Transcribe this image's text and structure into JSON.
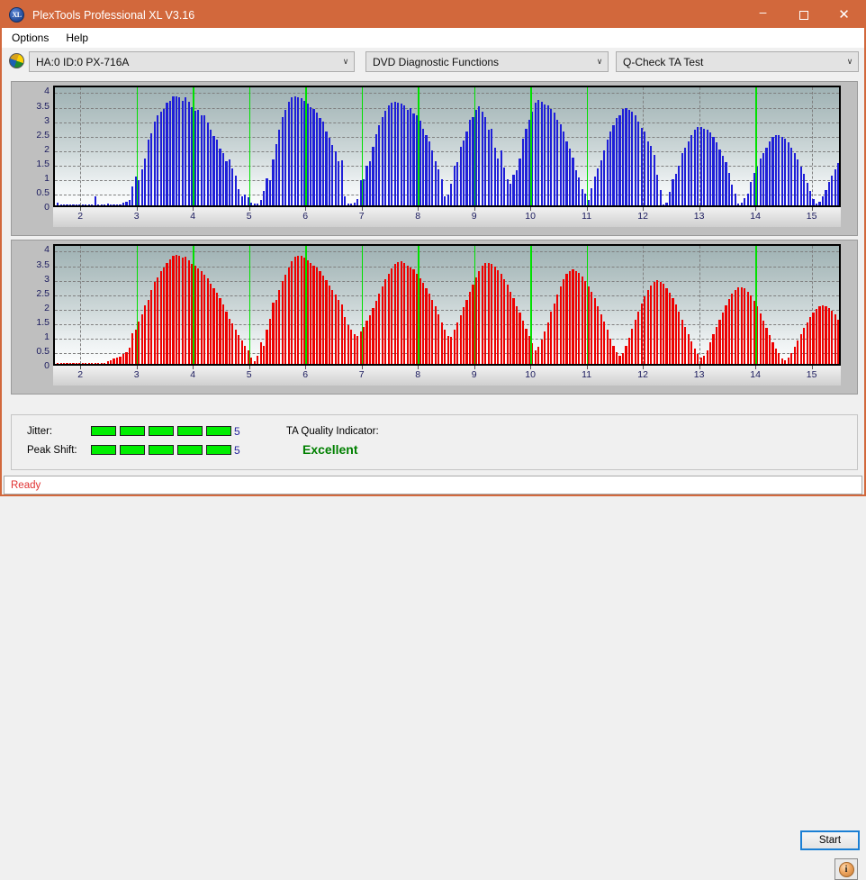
{
  "window": {
    "title": "PlexTools Professional XL V3.16",
    "icon": "xl-app-icon",
    "controls": {
      "minimize": "–",
      "maximize": "❑",
      "close": "✕"
    },
    "accent_color": "#d2683c"
  },
  "menubar": {
    "items": [
      {
        "label": "Options"
      },
      {
        "label": "Help"
      }
    ]
  },
  "toolbar": {
    "drive_icon": "disc-icon",
    "drive": {
      "value": "HA:0 ID:0  PX-716A",
      "chevron": "∨"
    },
    "category": {
      "value": "DVD Diagnostic Functions",
      "chevron": "∨"
    },
    "test": {
      "value": "Q-Check TA Test",
      "chevron": "∨"
    }
  },
  "results": {
    "jitter_label": "Jitter:",
    "jitter_value": "5",
    "jitter_segments": 5,
    "peak_shift_label": "Peak Shift:",
    "peak_shift_value": "5",
    "peak_shift_segments": 5,
    "quality_label": "TA Quality Indicator:",
    "quality_value": "Excellent",
    "quality_color": "#008000",
    "meter_color": "#00ee00"
  },
  "actions": {
    "start_label": "Start",
    "info_label": "i"
  },
  "statusbar": {
    "text": "Ready",
    "color": "#e03232"
  },
  "chart_data": [
    {
      "id": "ta-test-upper",
      "type": "bar",
      "title": "",
      "xlabel": "",
      "ylabel": "",
      "color": "#1f1fd8",
      "series_name": "TA Test Upper",
      "xlim": [
        1.55,
        15.55
      ],
      "ylim": [
        0,
        4.2
      ],
      "yticks": [
        0,
        0.5,
        1,
        1.5,
        2,
        2.5,
        3,
        3.5,
        4
      ],
      "ytick_labels": [
        "0",
        "0.5",
        "1",
        "1.5",
        "2",
        "2.5",
        "3",
        "3.5",
        "4"
      ],
      "xticks": [
        2,
        3,
        4,
        5,
        6,
        7,
        8,
        9,
        10,
        11,
        12,
        13,
        14,
        15
      ],
      "xtick_labels": [
        "2",
        "3",
        "4",
        "5",
        "6",
        "7",
        "8",
        "9",
        "10",
        "11",
        "12",
        "13",
        "14",
        "15"
      ],
      "grid": true,
      "markers": [
        3,
        4,
        5,
        6,
        7,
        8,
        9,
        10,
        11,
        14
      ],
      "marker_color": "#00e000",
      "bar_step": 0.0555,
      "x_start": 1.6,
      "values": [
        0.08,
        0.02,
        0.04,
        0.02,
        0.02,
        0.03,
        0.02,
        0.02,
        0.04,
        0.02,
        0.02,
        0.02,
        0.32,
        0.02,
        0.03,
        0.02,
        0.05,
        0.04,
        0.02,
        0.02,
        0.02,
        0.1,
        0.12,
        0.2,
        0.65,
        1.0,
        0.88,
        1.24,
        1.62,
        2.28,
        2.5,
        2.9,
        3.1,
        3.25,
        3.32,
        3.55,
        3.62,
        3.75,
        3.78,
        3.74,
        3.62,
        3.72,
        3.58,
        3.4,
        3.28,
        3.3,
        3.1,
        3.12,
        2.85,
        2.62,
        2.4,
        2.28,
        1.95,
        1.8,
        1.52,
        1.6,
        1.28,
        1.02,
        0.55,
        0.32,
        0.36,
        0.28,
        0.1,
        0.06,
        0.06,
        0.18,
        0.5,
        0.92,
        0.88,
        1.58,
        2.12,
        2.6,
        3.05,
        3.3,
        3.58,
        3.72,
        3.75,
        3.74,
        3.7,
        3.6,
        3.52,
        3.38,
        3.32,
        3.2,
        3.02,
        2.88,
        2.55,
        2.32,
        2.1,
        1.88,
        1.52,
        1.56,
        0.3,
        0.05,
        0.06,
        0.1,
        0.22,
        0.86,
        0.9,
        1.38,
        1.52,
        2.02,
        2.45,
        2.78,
        3.06,
        3.28,
        3.45,
        3.56,
        3.58,
        3.55,
        3.52,
        3.45,
        3.3,
        3.35,
        3.18,
        3.1,
        2.92,
        2.64,
        2.42,
        2.2,
        1.9,
        1.52,
        1.26,
        0.9,
        0.32,
        0.38,
        0.74,
        1.36,
        1.5,
        2.02,
        2.25,
        2.55,
        2.96,
        3.06,
        3.3,
        3.42,
        3.25,
        3.06,
        2.6,
        2.66,
        2.0,
        1.62,
        1.9,
        1.3,
        0.9,
        0.74,
        1.05,
        1.2,
        1.62,
        2.3,
        2.64,
        2.96,
        3.24,
        3.55,
        3.64,
        3.58,
        3.5,
        3.46,
        3.32,
        3.2,
        2.95,
        2.8,
        2.55,
        2.2,
        1.95,
        1.64,
        1.2,
        0.95,
        0.56,
        0.42,
        0.2,
        0.6,
        1.0,
        1.28,
        1.56,
        1.9,
        2.28,
        2.55,
        2.78,
        3.02,
        3.12,
        3.32,
        3.36,
        3.3,
        3.24,
        3.1,
        2.9,
        2.68,
        2.55,
        2.2,
        2.04,
        1.75,
        1.05,
        0.54,
        0.04,
        0.1,
        0.48,
        0.9,
        1.1,
        1.38,
        1.8,
        2.0,
        2.2,
        2.42,
        2.6,
        2.72,
        2.7,
        2.66,
        2.6,
        2.52,
        2.35,
        2.18,
        1.92,
        1.7,
        1.48,
        1.12,
        0.72,
        0.4,
        0.06,
        0.1,
        0.24,
        0.42,
        0.8,
        1.12,
        1.35,
        1.62,
        1.8,
        2.0,
        2.22,
        2.36,
        2.44,
        2.42,
        2.36,
        2.3,
        2.18,
        2.0,
        1.82,
        1.6,
        1.35,
        1.1,
        0.78,
        0.5,
        0.22,
        0.06,
        0.12,
        0.3,
        0.52,
        0.8,
        1.02,
        1.24,
        1.45,
        1.62,
        1.7,
        1.66,
        1.6,
        1.5,
        1.3,
        1.05,
        0.86,
        0.6,
        0.38,
        0.2,
        0.1,
        0.04,
        0.03,
        0.02,
        0.02,
        0.02,
        0.02,
        0.02,
        0.02,
        0.02,
        0.02,
        0.02,
        0.02,
        0.02,
        0.02,
        0.02,
        0.02,
        0.02,
        0.02,
        0.02,
        0.02,
        0.02,
        0.02,
        0.02,
        0.02,
        0.02,
        0.02,
        0.02,
        0.02,
        0.02,
        0.02,
        0.02,
        0.02,
        0.02,
        0.02,
        0.02,
        0.02,
        0.02,
        0.02,
        0.02,
        0.02,
        0.02,
        0.02,
        0.02,
        0.05,
        0.16,
        0.26,
        0.44,
        0.72,
        0.58,
        1.02,
        1.3,
        1.42,
        1.56,
        1.72,
        1.66,
        1.58,
        1.48,
        1.36,
        1.2,
        1.02,
        0.8,
        0.02,
        0.02,
        0.02,
        0.02,
        0.02,
        0.02,
        0.02,
        0.02,
        0.02,
        0.02,
        0.02,
        0.02,
        0.02,
        0.02,
        0.02,
        0.02,
        0.02,
        0.02,
        0.02,
        0.02,
        0.02,
        0.02,
        0.02,
        0.02,
        0.02,
        0.02,
        0.02,
        0.02
      ]
    },
    {
      "id": "ta-test-lower",
      "type": "bar",
      "title": "",
      "xlabel": "",
      "ylabel": "",
      "color": "#ee0000",
      "series_name": "TA Test Lower",
      "xlim": [
        1.55,
        15.55
      ],
      "ylim": [
        0,
        4.2
      ],
      "yticks": [
        0,
        0.5,
        1,
        1.5,
        2,
        2.5,
        3,
        3.5,
        4
      ],
      "ytick_labels": [
        "0",
        "0.5",
        "1",
        "1.5",
        "2",
        "2.5",
        "3",
        "3.5",
        "4"
      ],
      "xticks": [
        2,
        3,
        4,
        5,
        6,
        7,
        8,
        9,
        10,
        11,
        12,
        13,
        14,
        15
      ],
      "xtick_labels": [
        "2",
        "3",
        "4",
        "5",
        "6",
        "7",
        "8",
        "9",
        "10",
        "11",
        "12",
        "13",
        "14",
        "15"
      ],
      "grid": true,
      "markers": [
        3,
        4,
        5,
        6,
        7,
        8,
        9,
        10,
        11,
        14
      ],
      "marker_color": "#00e000",
      "bar_step": 0.0555,
      "x_start": 1.6,
      "values": [
        0.02,
        0.02,
        0.02,
        0.02,
        0.02,
        0.02,
        0.02,
        0.02,
        0.02,
        0.02,
        0.02,
        0.02,
        0.02,
        0.02,
        0.02,
        0.02,
        0.1,
        0.14,
        0.18,
        0.22,
        0.26,
        0.34,
        0.42,
        0.55,
        1.05,
        1.18,
        1.45,
        1.72,
        2.02,
        2.22,
        2.55,
        2.82,
        3.0,
        3.22,
        3.32,
        3.48,
        3.62,
        3.74,
        3.78,
        3.72,
        3.66,
        3.7,
        3.58,
        3.45,
        3.38,
        3.3,
        3.2,
        3.08,
        2.96,
        2.78,
        2.62,
        2.45,
        2.28,
        2.05,
        1.82,
        1.56,
        1.4,
        1.18,
        1.0,
        0.8,
        0.62,
        0.48,
        0.22,
        0.1,
        0.28,
        0.74,
        0.62,
        1.18,
        1.55,
        2.12,
        2.22,
        2.54,
        2.86,
        3.08,
        3.32,
        3.55,
        3.7,
        3.74,
        3.72,
        3.66,
        3.58,
        3.5,
        3.4,
        3.32,
        3.22,
        3.06,
        2.9,
        2.72,
        2.56,
        2.4,
        2.2,
        2.04,
        1.62,
        1.34,
        1.18,
        1.02,
        0.98,
        1.12,
        1.28,
        1.48,
        1.68,
        1.92,
        2.18,
        2.44,
        2.68,
        2.92,
        3.12,
        3.3,
        3.44,
        3.52,
        3.54,
        3.48,
        3.4,
        3.34,
        3.26,
        3.12,
        2.96,
        2.8,
        2.6,
        2.42,
        2.2,
        1.98,
        1.72,
        1.42,
        1.18,
        0.96,
        0.92,
        1.18,
        1.42,
        1.68,
        1.95,
        2.2,
        2.48,
        2.75,
        3.0,
        3.22,
        3.38,
        3.48,
        3.5,
        3.44,
        3.36,
        3.24,
        3.1,
        2.94,
        2.74,
        2.5,
        2.26,
        2.0,
        1.76,
        1.5,
        1.22,
        0.96,
        0.72,
        0.48,
        0.6,
        0.84,
        1.12,
        1.44,
        1.8,
        2.1,
        2.4,
        2.68,
        2.94,
        3.1,
        3.22,
        3.26,
        3.22,
        3.14,
        3.02,
        2.86,
        2.68,
        2.48,
        2.26,
        2.0,
        1.72,
        1.46,
        1.18,
        0.88,
        0.62,
        0.4,
        0.28,
        0.38,
        0.62,
        0.9,
        1.2,
        1.52,
        1.8,
        2.08,
        2.32,
        2.54,
        2.72,
        2.84,
        2.88,
        2.84,
        2.76,
        2.62,
        2.46,
        2.26,
        2.04,
        1.8,
        1.54,
        1.28,
        1.02,
        0.78,
        0.52,
        0.34,
        0.22,
        0.28,
        0.48,
        0.74,
        1.02,
        1.28,
        1.52,
        1.78,
        2.02,
        2.24,
        2.42,
        2.56,
        2.64,
        2.66,
        2.6,
        2.5,
        2.36,
        2.18,
        1.98,
        1.74,
        1.5,
        1.26,
        1.0,
        0.76,
        0.52,
        0.36,
        0.18,
        0.12,
        0.22,
        0.38,
        0.58,
        0.8,
        1.02,
        1.24,
        1.44,
        1.62,
        1.78,
        1.9,
        1.98,
        2.02,
        2.0,
        1.94,
        1.84,
        1.7,
        1.52,
        1.32,
        1.1,
        0.88,
        0.66,
        0.46,
        0.28,
        0.16,
        0.08,
        0.04,
        0.12,
        0.26,
        0.42,
        0.6,
        0.78,
        0.96,
        1.12,
        1.26,
        1.38,
        1.44,
        1.46,
        1.42,
        1.34,
        1.22,
        1.08,
        0.92,
        0.76,
        0.58,
        0.42,
        0.28,
        0.16,
        0.08,
        0.04,
        0.02,
        0.02,
        0.02,
        0.02,
        0.02,
        0.02,
        0.02,
        0.02,
        0.02,
        0.1,
        0.02,
        0.02,
        0.02,
        0.02,
        0.02,
        0.02,
        0.02,
        0.02,
        0.02,
        0.02,
        0.02,
        0.02,
        0.02,
        0.02,
        0.02,
        0.02,
        0.02,
        0.02,
        0.02,
        0.02,
        0.05,
        0.12,
        0.18,
        0.26,
        0.4,
        0.6,
        0.82,
        1.08,
        1.3,
        1.45,
        1.5,
        1.45,
        1.34,
        1.18,
        1.0,
        0.8,
        0.6,
        0.4,
        0.22,
        0.1,
        0.02,
        0.02,
        0.02,
        0.02,
        0.02,
        0.02,
        0.02,
        0.02,
        0.02,
        0.02,
        0.02,
        0.02,
        0.02,
        0.02,
        0.02,
        0.02,
        0.02,
        0.02,
        0.08
      ]
    }
  ]
}
